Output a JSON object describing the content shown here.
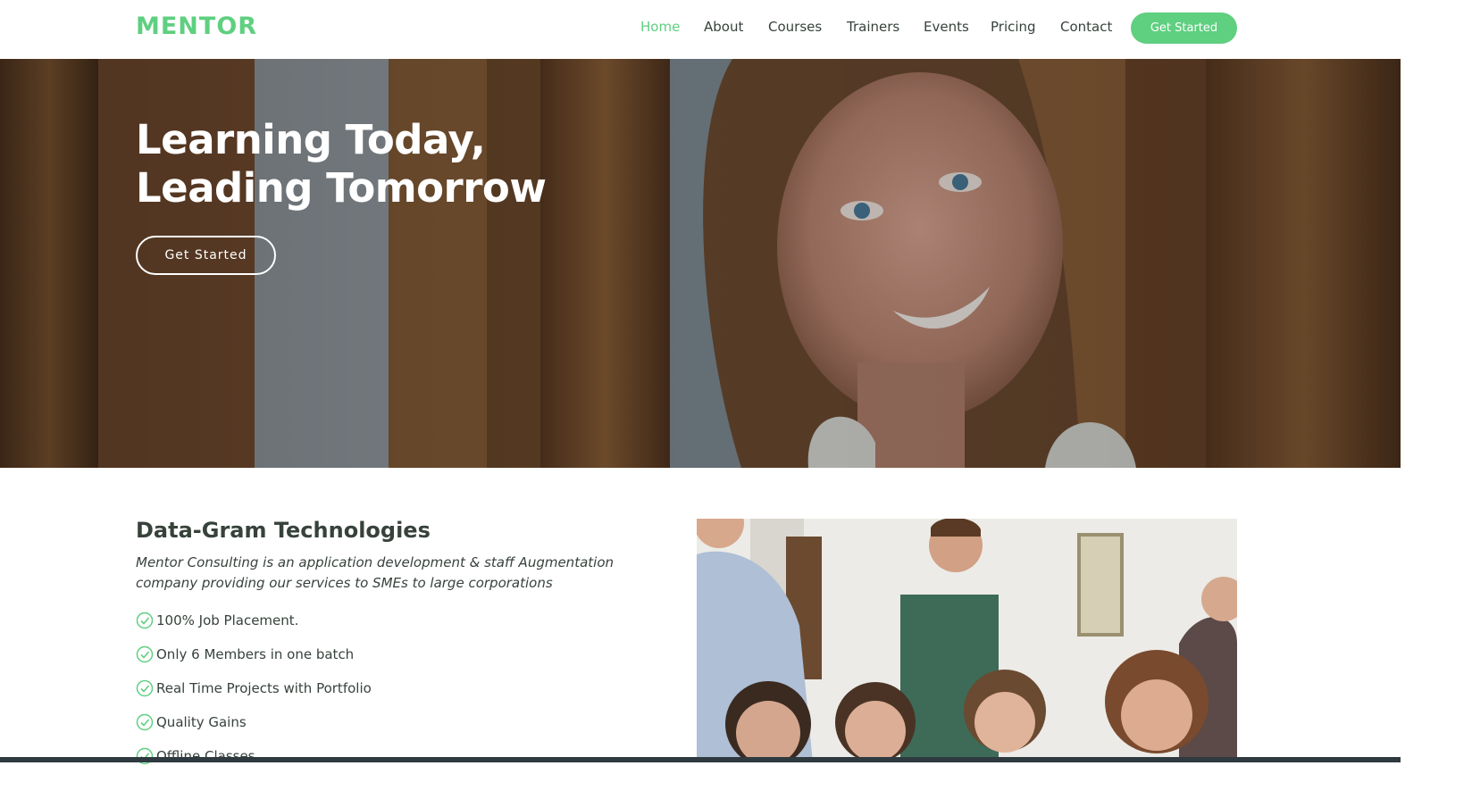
{
  "header": {
    "logo": "MENTOR",
    "nav": [
      "Home",
      "About",
      "Courses",
      "Trainers",
      "Events",
      "Pricing",
      "Contact"
    ],
    "cta": "Get Started"
  },
  "hero": {
    "title_line1": "Learning Today,",
    "title_line2": "Leading Tomorrow",
    "cta": "Get Started"
  },
  "about": {
    "title": "Data-Gram Technologies",
    "description": "Mentor Consulting is an application development & staff Augmentation company providing our services to SMEs to large corporations",
    "features": [
      "100% Job Placement.",
      "Only 6 Members in one batch",
      "Real Time Projects with Portfolio",
      "Quality Gains",
      "Offline Classes"
    ]
  },
  "colors": {
    "accent": "#5fcf80",
    "text": "#37423b"
  }
}
